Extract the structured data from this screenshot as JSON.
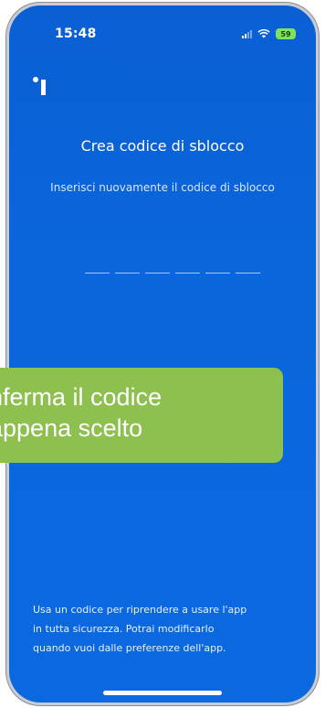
{
  "status_bar": {
    "time": "15:48",
    "battery": "59",
    "icons": [
      "signal-icon",
      "wifi-icon",
      "battery-icon"
    ]
  },
  "app": {
    "logo_icon": "app-logo-icon"
  },
  "screen": {
    "title": "Crea codice di sblocco",
    "subtitle": "Inserisci nuovamente il codice di sblocco",
    "pin_slots": 6,
    "footer_line1": "Usa un codice per riprendere a usare l'app",
    "footer_line2": "in tutta sicurezza. Potrai modificarlo",
    "footer_line3": "quando vuoi dalle preferenze dell'app."
  },
  "callout": {
    "line1": "nferma il codice",
    "line2": "appena scelto"
  },
  "colors": {
    "background": "#0b66dc",
    "callout": "#8dc04f",
    "battery": "#7ee35a"
  }
}
